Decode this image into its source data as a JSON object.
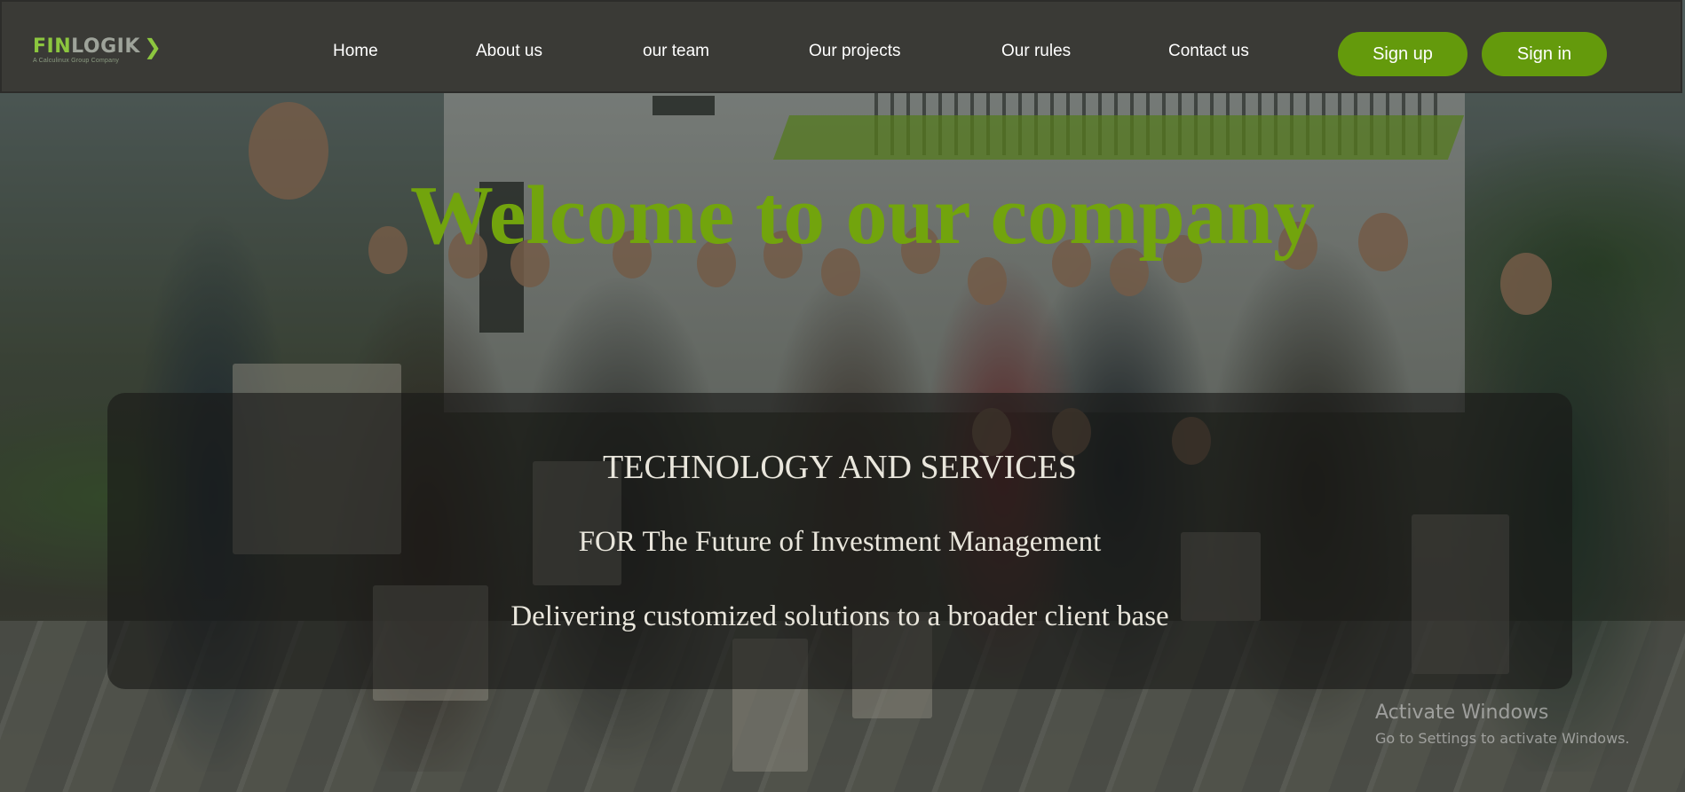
{
  "brand": {
    "logo_part1": "FIN",
    "logo_part2": "LOGIK",
    "logo_chevron": "❯",
    "tagline": "A Calculinux Group Company",
    "accent_color": "#649a0c",
    "title_color": "#72a40d"
  },
  "nav": {
    "items": [
      {
        "label": "Home"
      },
      {
        "label": "About us"
      },
      {
        "label": "our team"
      },
      {
        "label": "Our projects"
      },
      {
        "label": "Our rules"
      },
      {
        "label": "Contact us"
      }
    ],
    "signup_label": "Sign up",
    "signin_label": "Sign in"
  },
  "hero": {
    "title": "Welcome to our company",
    "panel": {
      "line1": "TECHNOLOGY AND SERVICES",
      "line2": "FOR The Future of Investment Management",
      "line3": "Delivering customized solutions to a broader client base"
    }
  },
  "watermark": {
    "title": "Activate Windows",
    "subtitle": "Go to Settings to activate Windows."
  }
}
